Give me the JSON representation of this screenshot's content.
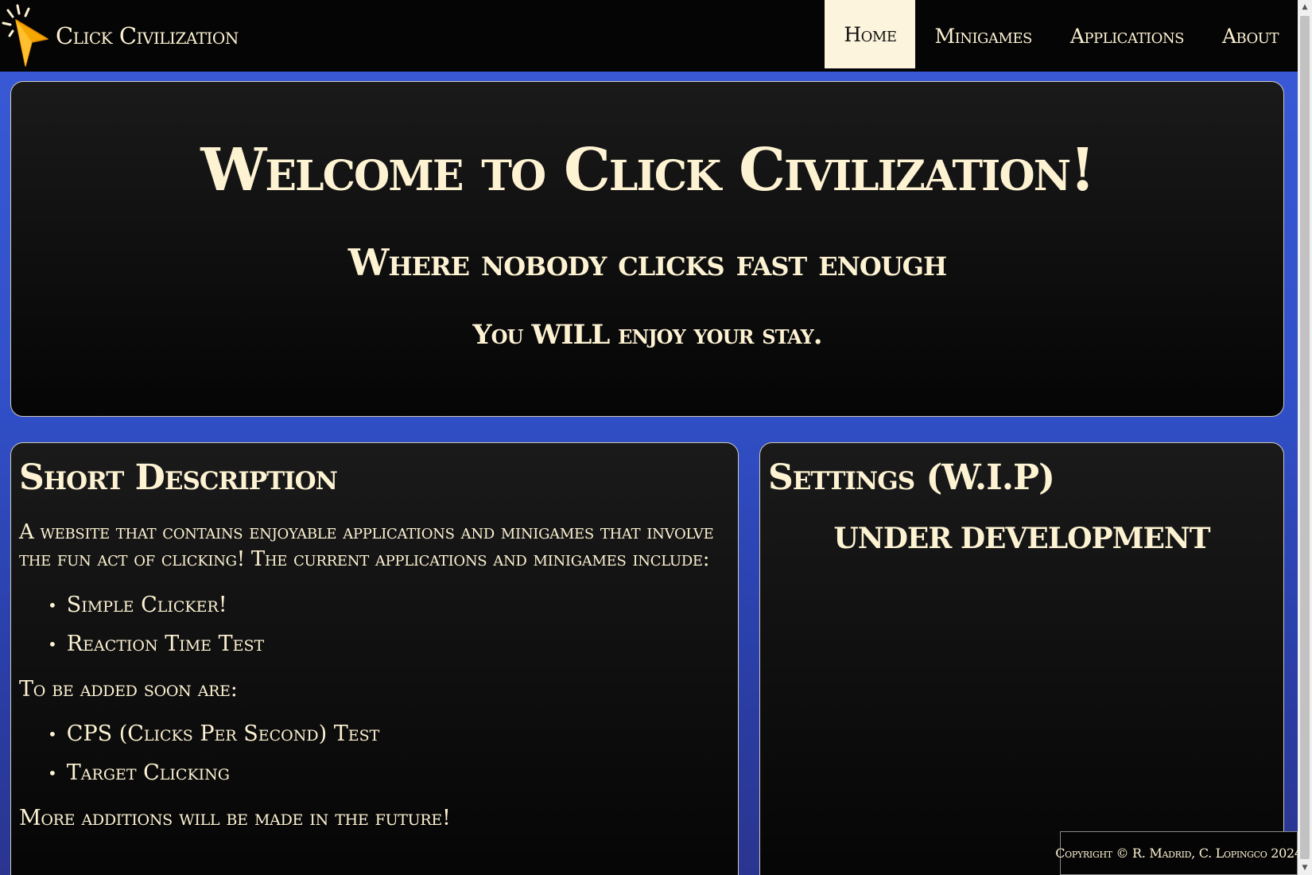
{
  "brand": {
    "name": "Click Civilization",
    "logo_icon": "cursor-click-icon"
  },
  "nav": {
    "items": [
      {
        "label": "Home",
        "active": true
      },
      {
        "label": "Minigames",
        "active": false
      },
      {
        "label": "Applications",
        "active": false
      },
      {
        "label": "About",
        "active": false
      }
    ]
  },
  "hero": {
    "title": "Welcome to Click Civilization!",
    "subtitle": "Where nobody clicks fast enough",
    "tagline": "You WILL enjoy your stay."
  },
  "description": {
    "title": "Short Description",
    "intro": "A website that contains enjoyable applications and minigames that involve the fun act of clicking! The current applications and minigames include:",
    "current_items": [
      "Simple Clicker!",
      "Reaction Time Test"
    ],
    "soon_heading": "To be added soon are:",
    "soon_items": [
      "CPS (Clicks Per Second) Test",
      "Target Clicking"
    ],
    "closing": "More additions will be made in the future!"
  },
  "settings": {
    "title": "Settings (W.I.P)",
    "status": "UNDER DEVELOPMENT"
  },
  "footer": {
    "copyright": "Copyright © R. Madrid, C. Lopingco 2024"
  },
  "colors": {
    "text": "#fdf2d2",
    "background_blue": "#3a5ad8",
    "card_bg": "#0a0a0a",
    "nav_active_bg": "#fdf4dd",
    "logo_yellow": "#f6a800"
  }
}
